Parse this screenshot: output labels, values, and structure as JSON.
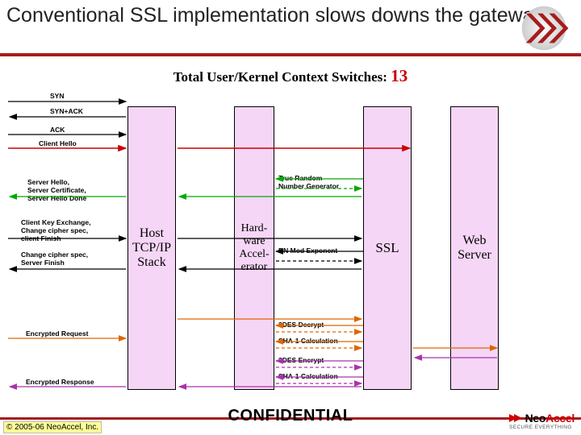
{
  "title": "Conventional SSL implementation slows downs the gateway",
  "context_label": "Total User/Kernel Context Switches:",
  "context_count": "13",
  "boxes": {
    "host": "Host\nTCP/IP\nStack",
    "hw": "Hard-\nware\nAccel-\nerator",
    "ssl": "SSL",
    "web": "Web\nServer"
  },
  "messages": {
    "syn": "SYN",
    "synack": "SYN+ACK",
    "ack": "ACK",
    "client_hello": "Client Hello",
    "server_hello": "Server Hello,\nServer Certificate,\nServer Hello Done",
    "ckex": "Client Key Exchange,\nChange cipher spec,\nclient Finish",
    "ccs": "Change cipher spec,\nServer Finish",
    "enc_req": "Encrypted Request",
    "enc_resp": "Encrypted Response"
  },
  "hw_steps": {
    "rng": "True Random\nNumber Generator",
    "bn": "BN Mod Exponent",
    "dec3": "3DES Decrypt",
    "sha1a": "SHA-1 Calculation",
    "enc3": "3DES Encrypt",
    "sha1b": "SHA-1 Calculation"
  },
  "footer": {
    "copyright": "© 2005-06 NeoAccel, Inc.",
    "conf": "CONFIDENTIAL",
    "brand_neo": "Neo",
    "brand_accel": "Accel",
    "tagline": "SECURE EVERYTHING"
  }
}
